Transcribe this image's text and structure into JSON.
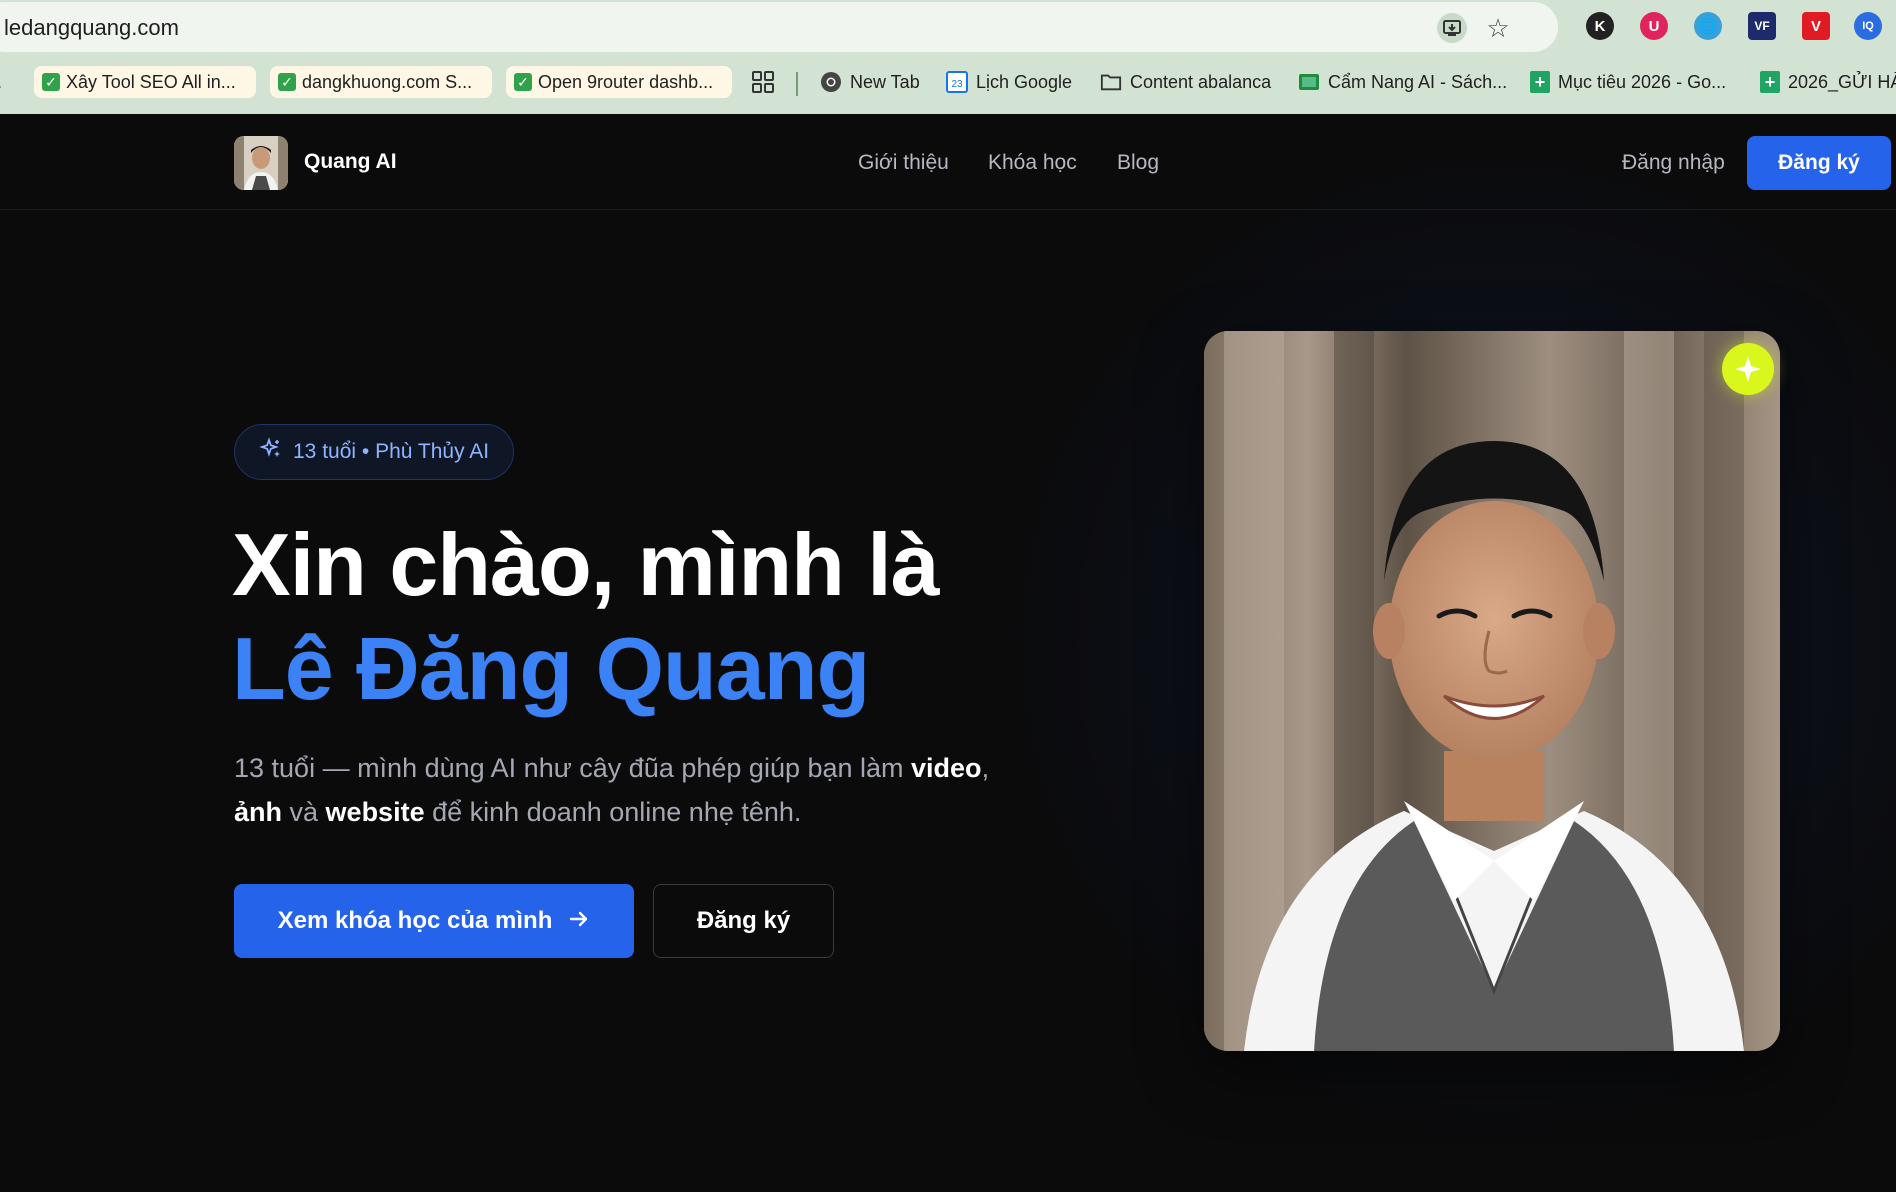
{
  "browser": {
    "url": "ledangquang.com",
    "bookmarks": [
      {
        "label": "Xây Tool SEO All in...",
        "icon": "checkbox-icon"
      },
      {
        "label": "dangkhuong.com S...",
        "icon": "checkbox-icon"
      },
      {
        "label": "Open 9router dashb...",
        "icon": "checkbox-icon"
      },
      {
        "label": "New Tab",
        "icon": "chrome-icon"
      },
      {
        "label": "Lịch Google",
        "icon": "calendar-icon"
      },
      {
        "label": "Content abalanca",
        "icon": "folder-icon"
      },
      {
        "label": "Cẩm Nang AI - Sách...",
        "icon": "classroom-icon"
      },
      {
        "label": "Mục tiêu 2026 - Go...",
        "icon": "sheets-icon"
      },
      {
        "label": "2026_GỬI HÀ",
        "icon": "sheets-icon"
      }
    ],
    "calendar_day": "23",
    "extensions": [
      "K",
      "U",
      "V",
      "IQ"
    ]
  },
  "site": {
    "brand": "Quang AI",
    "nav": {
      "items": [
        "Giới thiệu",
        "Khóa học",
        "Blog"
      ],
      "login": "Đăng nhập",
      "signup": "Đăng ký"
    },
    "hero": {
      "badge": "13 tuổi • Phù Thủy AI",
      "heading_line1": "Xin chào, mình là",
      "heading_name": "Lê Đăng Quang",
      "desc_part1": "13 tuổi — mình dùng AI như cây đũa phép giúp bạn làm ",
      "desc_bold1": "video",
      "desc_part2": ", ",
      "desc_bold2": "ảnh",
      "desc_part3": " và ",
      "desc_bold3": "website",
      "desc_part4": " để kinh doanh online nhẹ tênh.",
      "cta_primary": "Xem khóa học của mình",
      "cta_secondary": "Đăng ký"
    },
    "colors": {
      "accent": "#2563eb",
      "name_blue": "#3b82f6",
      "spark": "#d9f71c",
      "background": "#0b0b0c"
    }
  }
}
